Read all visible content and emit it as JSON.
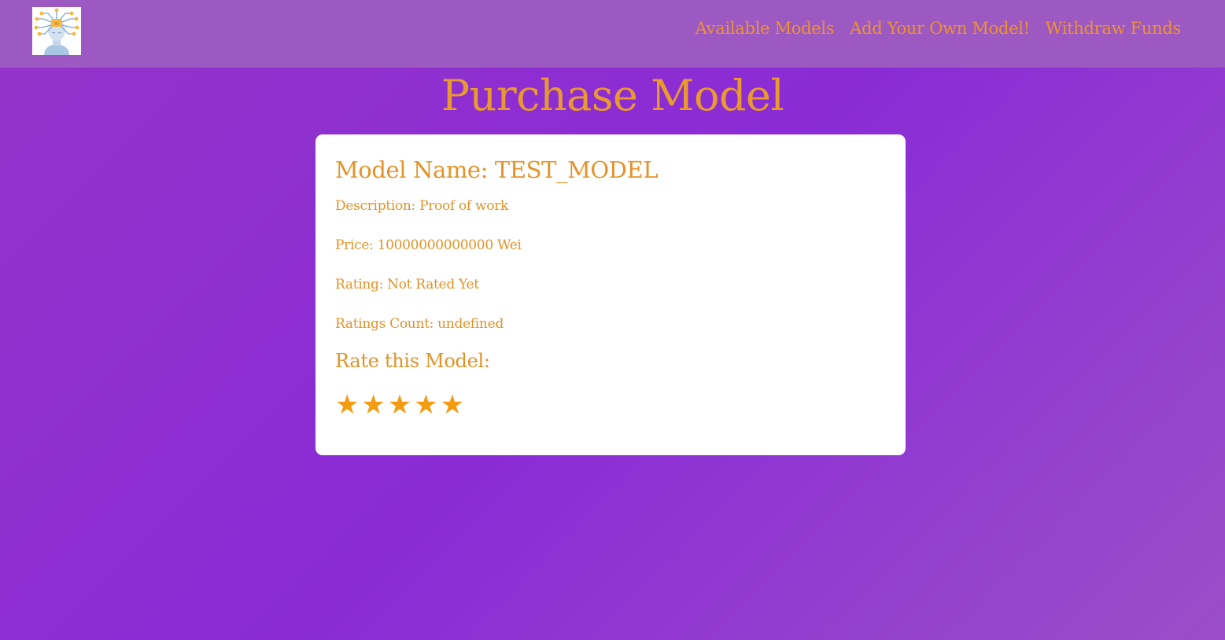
{
  "nav": {
    "logo_icon": "ai-head-circuit-icon",
    "links": [
      {
        "label": "Available Models"
      },
      {
        "label": "Add Your Own Model!"
      },
      {
        "label": "Withdraw Funds"
      }
    ]
  },
  "page": {
    "title": "Purchase Model"
  },
  "model": {
    "name_line": "Model Name: TEST_MODEL",
    "description_line": "Description: Proof of work",
    "price_line": "Price: 10000000000000 Wei",
    "rating_line": "Rating: Not Rated Yet",
    "ratings_count_line": "Ratings Count: undefined"
  },
  "rate": {
    "heading": "Rate this Model:",
    "stars": [
      "★",
      "★",
      "★",
      "★",
      "★"
    ],
    "max": 5
  },
  "colors": {
    "accent": "#e99a2e",
    "nav_bg": "#9b59c1",
    "bg": "#8a2bd6",
    "star": "#f39c12"
  }
}
